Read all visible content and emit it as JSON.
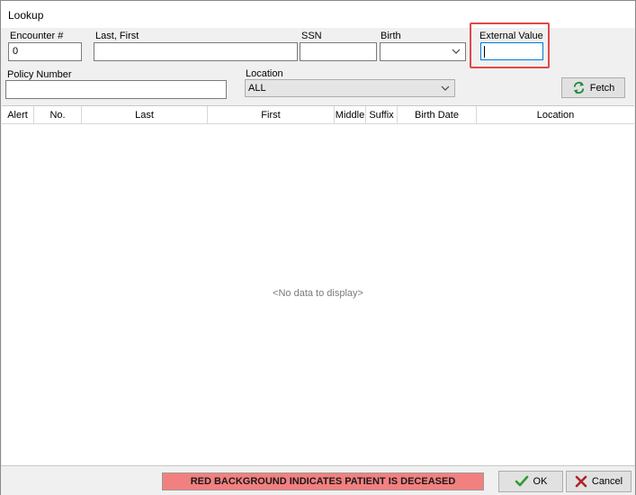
{
  "window": {
    "title": "Lookup"
  },
  "filters": {
    "encounter": {
      "label": "Encounter #",
      "value": "0"
    },
    "last_first": {
      "label": "Last, First",
      "value": ""
    },
    "ssn": {
      "label": "SSN",
      "value": ""
    },
    "birth": {
      "label": "Birth",
      "value": ""
    },
    "external_value": {
      "label": "External Value",
      "value": ""
    },
    "policy_number": {
      "label": "Policy Number",
      "value": ""
    },
    "location": {
      "label": "Location",
      "value": "ALL"
    }
  },
  "buttons": {
    "fetch": {
      "label": "Fetch",
      "icon": "refresh-arrows-icon"
    },
    "ok": {
      "label": "OK",
      "icon": "checkmark-icon"
    },
    "cancel": {
      "label": "Cancel",
      "icon": "x-icon"
    }
  },
  "grid": {
    "columns": [
      "Alert",
      "No.",
      "Last",
      "First",
      "Middle",
      "Suffix",
      "Birth Date",
      "Location"
    ],
    "rows": [],
    "empty_text": "<No data to display>"
  },
  "status": {
    "deceased_legend": "RED BACKGROUND INDICATES PATIENT IS DECEASED",
    "deceased_color": "#f38080"
  },
  "colors": {
    "highlight": "#e0484a",
    "focus_border": "#0078d7"
  }
}
